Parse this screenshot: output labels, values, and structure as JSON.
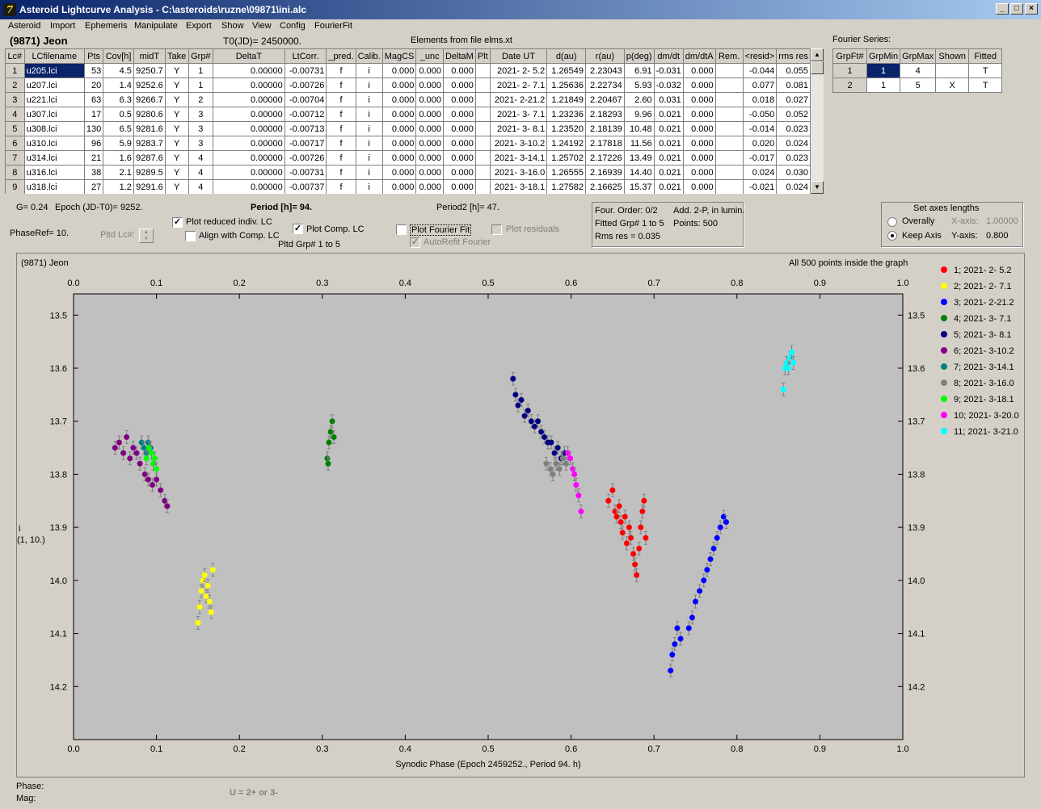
{
  "window": {
    "title": "Asteroid Lightcurve Analysis - C:\\asteroids\\ruzne\\09871\\ini.alc",
    "icon_glyph": "7"
  },
  "menu": [
    "Asteroid",
    "Import",
    "Ephemeris",
    "Manipulate",
    "Export",
    "Show",
    "View",
    "Config",
    "FourierFit"
  ],
  "header": {
    "asteroid": "(9871) Jeon",
    "t0": "T0(JD)= 2450000.",
    "elements": "Elements from file elms.xt",
    "fourier_series_label": "Fourier Series:"
  },
  "table": {
    "columns": [
      "Lc#",
      "LCfilename",
      "Pts",
      "Cov[h]",
      "midT",
      "Take",
      "Grp#",
      "DeltaT",
      "LtCorr.",
      "_pred.",
      "Calib.",
      "MagCS",
      "_unc",
      "DeltaM",
      "Plt",
      "Date UT",
      "d(au)",
      "r(au)",
      "p(deg)",
      "dm/dt",
      "dm/dtA",
      "Rem.",
      "<resid>",
      "rms res"
    ],
    "rows": [
      [
        "1",
        "u205.lci",
        "53",
        "4.5",
        "9250.7",
        "Y",
        "1",
        "0.00000",
        "-0.00731",
        "f",
        "i",
        "0.000",
        "0.000",
        "0.000",
        "",
        "2021- 2- 5.2",
        "1.26549",
        "2.23043",
        "6.91",
        "-0.031",
        "0.000",
        "",
        "-0.044",
        "0.055"
      ],
      [
        "2",
        "u207.lci",
        "20",
        "1.4",
        "9252.6",
        "Y",
        "1",
        "0.00000",
        "-0.00726",
        "f",
        "i",
        "0.000",
        "0.000",
        "0.000",
        "",
        "2021- 2- 7.1",
        "1.25636",
        "2.22734",
        "5.93",
        "-0.032",
        "0.000",
        "",
        "0.077",
        "0.081"
      ],
      [
        "3",
        "u221.lci",
        "63",
        "6.3",
        "9266.7",
        "Y",
        "2",
        "0.00000",
        "-0.00704",
        "f",
        "i",
        "0.000",
        "0.000",
        "0.000",
        "",
        "2021- 2-21.2",
        "1.21849",
        "2.20467",
        "2.60",
        "0.031",
        "0.000",
        "",
        "0.018",
        "0.027"
      ],
      [
        "4",
        "u307.lci",
        "17",
        "0.5",
        "9280.6",
        "Y",
        "3",
        "0.00000",
        "-0.00712",
        "f",
        "i",
        "0.000",
        "0.000",
        "0.000",
        "",
        "2021- 3- 7.1",
        "1.23236",
        "2.18293",
        "9.96",
        "0.021",
        "0.000",
        "",
        "-0.050",
        "0.052"
      ],
      [
        "5",
        "u308.lci",
        "130",
        "6.5",
        "9281.6",
        "Y",
        "3",
        "0.00000",
        "-0.00713",
        "f",
        "i",
        "0.000",
        "0.000",
        "0.000",
        "",
        "2021- 3- 8.1",
        "1.23520",
        "2.18139",
        "10.48",
        "0.021",
        "0.000",
        "",
        "-0.014",
        "0.023"
      ],
      [
        "6",
        "u310.lci",
        "96",
        "5.9",
        "9283.7",
        "Y",
        "3",
        "0.00000",
        "-0.00717",
        "f",
        "i",
        "0.000",
        "0.000",
        "0.000",
        "",
        "2021- 3-10.2",
        "1.24192",
        "2.17818",
        "11.56",
        "0.021",
        "0.000",
        "",
        "0.020",
        "0.024"
      ],
      [
        "7",
        "u314.lci",
        "21",
        "1.6",
        "9287.6",
        "Y",
        "4",
        "0.00000",
        "-0.00726",
        "f",
        "i",
        "0.000",
        "0.000",
        "0.000",
        "",
        "2021- 3-14.1",
        "1.25702",
        "2.17226",
        "13.49",
        "0.021",
        "0.000",
        "",
        "-0.017",
        "0.023"
      ],
      [
        "8",
        "u316.lci",
        "38",
        "2.1",
        "9289.5",
        "Y",
        "4",
        "0.00000",
        "-0.00731",
        "f",
        "i",
        "0.000",
        "0.000",
        "0.000",
        "",
        "2021- 3-16.0",
        "1.26555",
        "2.16939",
        "14.40",
        "0.021",
        "0.000",
        "",
        "0.024",
        "0.030"
      ],
      [
        "9",
        "u318.lci",
        "27",
        "1.2",
        "9291.6",
        "Y",
        "4",
        "0.00000",
        "-0.00737",
        "f",
        "i",
        "0.000",
        "0.000",
        "0.000",
        "",
        "2021- 3-18.1",
        "1.27582",
        "2.16625",
        "15.37",
        "0.021",
        "0.000",
        "",
        "-0.021",
        "0.024"
      ]
    ]
  },
  "fourier_table": {
    "columns": [
      "GrpFt#",
      "GrpMin",
      "GrpMax",
      "Shown",
      "Fitted"
    ],
    "rows": [
      [
        "1",
        "1",
        "4",
        "",
        "T"
      ],
      [
        "2",
        "1",
        "5",
        "X",
        "T"
      ]
    ]
  },
  "controls": {
    "g": "G= 0.24",
    "epoch": "Epoch (JD-T0)= 9252.",
    "period": "Period [h]= 94.",
    "period2": "Period2 [h]= 47.",
    "phaseref": "PhaseRef= 10.",
    "pltd_lc": "Pltd Lc#:",
    "plot_reduced": "Plot reduced indiv. LC",
    "align_comp": "Align with Comp. LC",
    "plot_comp": "Plot Comp. LC",
    "pltd_grp": "Pltd Grp#  1   to   5",
    "plot_fourier": "Plot Fourier Fit",
    "autorefit": "AutoRefit Fourier",
    "plot_residuals": "Plot residuals",
    "checked_mark": "✓"
  },
  "fourier_info": {
    "order": "Four. Order:  0/2",
    "add": "Add. 2-P, in lumin.",
    "fitted": "Fitted Grp# 1 to 5",
    "points": "Points: 500",
    "rms": "Rms res     = 0.035"
  },
  "axes_box": {
    "title": "Set axes lengths",
    "overally": "Overally",
    "keep_axis": "Keep Axis",
    "x_axis_label": "X-axis:",
    "x_axis_value": "1.00000",
    "y_axis_label": "Y-axis:",
    "y_axis_value": "0.800"
  },
  "status": {
    "phase": "Phase:",
    "mag": "Mag:",
    "hint": "U = 2+ or 3-"
  },
  "chart_data": {
    "type": "scatter",
    "title": "(9871) Jeon",
    "annotation": "All 500 points inside the graph",
    "xlabel": "Synodic Phase (Epoch 2459252., Period 94. h)",
    "ylabel": "i",
    "ylabel2": "(1, 10.)",
    "xlim": [
      0,
      1
    ],
    "ylim": [
      14.3,
      13.46
    ],
    "y_inverted": true,
    "xticks": [
      "0.0",
      "0.1",
      "0.2",
      "0.3",
      "0.4",
      "0.5",
      "0.6",
      "0.7",
      "0.8",
      "0.9",
      "1.0"
    ],
    "yticks": [
      "13.5",
      "13.6",
      "13.7",
      "13.8",
      "13.9",
      "14.0",
      "14.1",
      "14.2"
    ],
    "grid": false,
    "error_bars": true,
    "legend_position": "right",
    "series": [
      {
        "name": "1; 2021- 2- 5.2",
        "color": "#ff0000",
        "points": [
          [
            0.645,
            13.85
          ],
          [
            0.65,
            13.83
          ],
          [
            0.653,
            13.87
          ],
          [
            0.655,
            13.88
          ],
          [
            0.658,
            13.86
          ],
          [
            0.66,
            13.89
          ],
          [
            0.662,
            13.91
          ],
          [
            0.665,
            13.88
          ],
          [
            0.667,
            13.93
          ],
          [
            0.67,
            13.9
          ],
          [
            0.672,
            13.92
          ],
          [
            0.675,
            13.95
          ],
          [
            0.677,
            13.97
          ],
          [
            0.679,
            13.99
          ],
          [
            0.682,
            13.94
          ],
          [
            0.684,
            13.9
          ],
          [
            0.686,
            13.87
          ],
          [
            0.688,
            13.85
          ],
          [
            0.69,
            13.92
          ]
        ]
      },
      {
        "name": "2; 2021- 2- 7.1",
        "color": "#ffff00",
        "points": [
          [
            0.15,
            14.08
          ],
          [
            0.152,
            14.05
          ],
          [
            0.154,
            14.02
          ],
          [
            0.156,
            14.0
          ],
          [
            0.158,
            13.99
          ],
          [
            0.16,
            14.03
          ],
          [
            0.162,
            14.01
          ],
          [
            0.164,
            14.04
          ],
          [
            0.166,
            14.06
          ],
          [
            0.168,
            13.98
          ]
        ]
      },
      {
        "name": "3; 2021- 2-21.2",
        "color": "#0000ff",
        "points": [
          [
            0.72,
            14.17
          ],
          [
            0.722,
            14.14
          ],
          [
            0.725,
            14.12
          ],
          [
            0.728,
            14.09
          ],
          [
            0.732,
            14.11
          ],
          [
            0.742,
            14.09
          ],
          [
            0.746,
            14.07
          ],
          [
            0.75,
            14.04
          ],
          [
            0.755,
            14.02
          ],
          [
            0.76,
            14.0
          ],
          [
            0.764,
            13.98
          ],
          [
            0.768,
            13.96
          ],
          [
            0.772,
            13.94
          ],
          [
            0.776,
            13.92
          ],
          [
            0.78,
            13.9
          ],
          [
            0.784,
            13.88
          ],
          [
            0.787,
            13.89
          ]
        ]
      },
      {
        "name": "4; 2021- 3- 7.1",
        "color": "#008000",
        "points": [
          [
            0.306,
            13.77
          ],
          [
            0.308,
            13.74
          ],
          [
            0.31,
            13.72
          ],
          [
            0.312,
            13.7
          ],
          [
            0.314,
            13.73
          ],
          [
            0.307,
            13.78
          ]
        ]
      },
      {
        "name": "5; 2021- 3- 8.1",
        "color": "#000080",
        "points": [
          [
            0.53,
            13.62
          ],
          [
            0.533,
            13.65
          ],
          [
            0.536,
            13.67
          ],
          [
            0.54,
            13.66
          ],
          [
            0.544,
            13.69
          ],
          [
            0.548,
            13.68
          ],
          [
            0.552,
            13.7
          ],
          [
            0.556,
            13.71
          ],
          [
            0.56,
            13.7
          ],
          [
            0.564,
            13.72
          ],
          [
            0.568,
            13.73
          ],
          [
            0.572,
            13.74
          ],
          [
            0.576,
            13.74
          ],
          [
            0.58,
            13.76
          ],
          [
            0.584,
            13.75
          ],
          [
            0.588,
            13.77
          ],
          [
            0.592,
            13.76
          ]
        ]
      },
      {
        "name": "6; 2021- 3-10.2",
        "color": "#800080",
        "points": [
          [
            0.05,
            13.75
          ],
          [
            0.055,
            13.74
          ],
          [
            0.06,
            13.76
          ],
          [
            0.064,
            13.73
          ],
          [
            0.068,
            13.77
          ],
          [
            0.072,
            13.75
          ],
          [
            0.076,
            13.76
          ],
          [
            0.08,
            13.78
          ],
          [
            0.086,
            13.8
          ],
          [
            0.09,
            13.81
          ],
          [
            0.095,
            13.82
          ],
          [
            0.1,
            13.81
          ],
          [
            0.105,
            13.83
          ],
          [
            0.11,
            13.85
          ],
          [
            0.113,
            13.86
          ]
        ]
      },
      {
        "name": "7; 2021- 3-14.1",
        "color": "#008080",
        "points": [
          [
            0.082,
            13.74
          ],
          [
            0.085,
            13.75
          ],
          [
            0.088,
            13.76
          ],
          [
            0.09,
            13.74
          ],
          [
            0.093,
            13.75
          ]
        ]
      },
      {
        "name": "8; 2021- 3-16.0",
        "color": "#808080",
        "points": [
          [
            0.57,
            13.78
          ],
          [
            0.575,
            13.79
          ],
          [
            0.578,
            13.8
          ],
          [
            0.582,
            13.78
          ],
          [
            0.586,
            13.79
          ],
          [
            0.59,
            13.77
          ],
          [
            0.594,
            13.78
          ]
        ]
      },
      {
        "name": "9; 2021- 3-18.1",
        "color": "#00ff00",
        "points": [
          [
            0.088,
            13.77
          ],
          [
            0.091,
            13.75
          ],
          [
            0.094,
            13.76
          ],
          [
            0.096,
            13.78
          ],
          [
            0.098,
            13.77
          ],
          [
            0.1,
            13.79
          ]
        ]
      },
      {
        "name": "10; 2021- 3-20.0",
        "color": "#ff00ff",
        "points": [
          [
            0.596,
            13.76
          ],
          [
            0.599,
            13.77
          ],
          [
            0.602,
            13.79
          ],
          [
            0.604,
            13.8
          ],
          [
            0.606,
            13.82
          ],
          [
            0.609,
            13.84
          ],
          [
            0.612,
            13.87
          ]
        ]
      },
      {
        "name": "11; 2021- 3-21.0",
        "color": "#00ffff",
        "points": [
          [
            0.856,
            13.64
          ],
          [
            0.858,
            13.6
          ],
          [
            0.86,
            13.59
          ],
          [
            0.862,
            13.6
          ],
          [
            0.864,
            13.58
          ],
          [
            0.866,
            13.57
          ],
          [
            0.868,
            13.59
          ]
        ]
      }
    ]
  }
}
